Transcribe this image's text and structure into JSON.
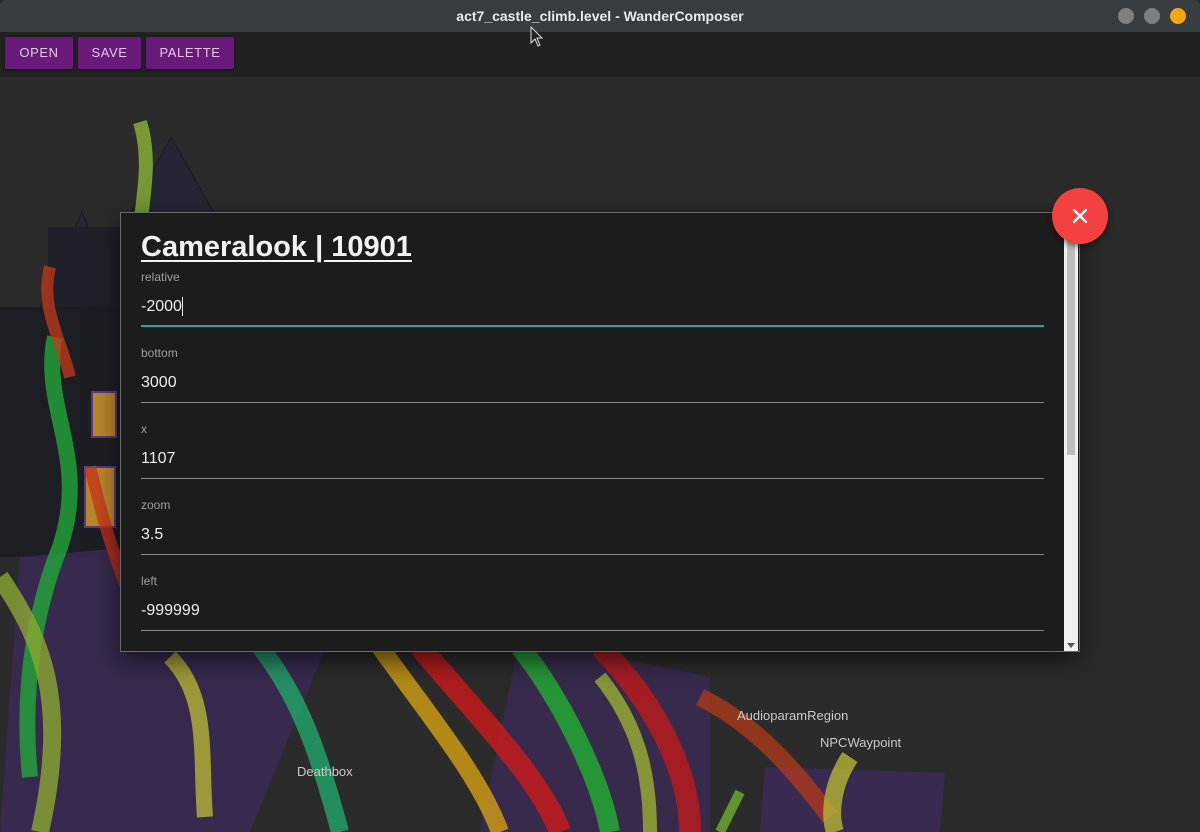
{
  "window": {
    "title": "act7_castle_climb.level - WanderComposer"
  },
  "toolbar": {
    "open_label": "OPEN",
    "save_label": "SAVE",
    "palette_label": "PALETTE"
  },
  "canvas": {
    "labels": {
      "deathbox": "Deathbox",
      "audio": "AudioparamRegion",
      "npc": "NPCWaypoint"
    }
  },
  "dialog": {
    "title": "Cameralook | 10901",
    "fields": [
      {
        "label": "relative",
        "value": "-2000"
      },
      {
        "label": "bottom",
        "value": "3000"
      },
      {
        "label": "x",
        "value": "1107"
      },
      {
        "label": "zoom",
        "value": "3.5"
      },
      {
        "label": "left",
        "value": "-999999"
      }
    ],
    "close_icon": "close-icon"
  },
  "colors": {
    "accent": "#26a69a",
    "toolbar_button": "#6a1b7a",
    "close_button": "#f44040"
  }
}
